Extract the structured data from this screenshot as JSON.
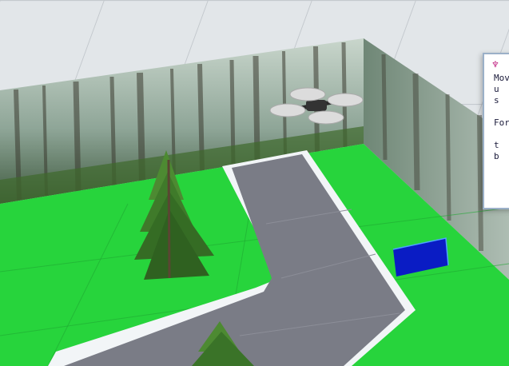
{
  "scene": {
    "title": "",
    "colors": {
      "floor": "#dfe3e6",
      "floor_grid": "#c3c8cd",
      "grass": "#27d43c",
      "road": "#7a7c86",
      "road_edge": "#f2f5f7",
      "target_pad": "#0a1cc4",
      "tree": "#3a7a2c",
      "drone_prop": "#d8d8d8"
    },
    "objects": [
      {
        "name": "drone",
        "icon": "drone-icon"
      },
      {
        "name": "pine-tree-1",
        "icon": "pine-tree-icon"
      },
      {
        "name": "pine-tree-2",
        "icon": "pine-tree-icon"
      },
      {
        "name": "target-pad",
        "icon": "blue-square"
      }
    ]
  },
  "side_panel": {
    "icon": "app-logo-icon",
    "lines": [
      "Movi",
      "u",
      "s",
      "",
      "For",
      "",
      "t",
      "b"
    ]
  }
}
